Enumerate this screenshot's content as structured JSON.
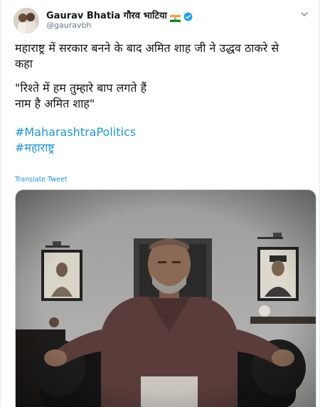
{
  "author": {
    "display_name": "Gaurav Bhatia गौरव भाटिया",
    "handle": "@gauravbh",
    "flag_icon": "india-flag-icon",
    "verified_icon": "verified-badge-icon"
  },
  "tweet": {
    "lines": [
      "महाराष्ट्र में सरकार बनने के बाद अमित शाह जी ने उद्धव ठाकरे से",
      "कहा",
      "\"रिश्ते में हम तुम्हारे बाप लगते हैं",
      "नाम है अमित शाह\""
    ],
    "hashtags": [
      "#MaharashtraPolitics",
      "#महाराष्ट्र"
    ],
    "translate_label": "Translate Tweet"
  },
  "colors": {
    "link": "#1b95e0",
    "text": "#14171a",
    "secondary": "#657786",
    "verified": "#1da1f2"
  },
  "icons": {
    "more_menu": "chevron-down-icon"
  }
}
